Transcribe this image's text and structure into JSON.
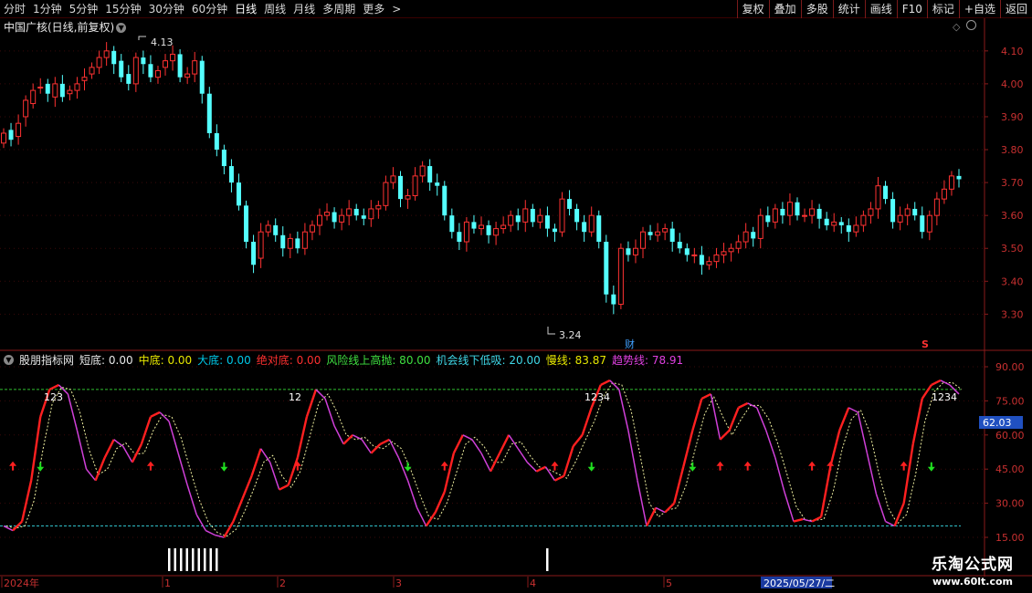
{
  "toolbar": {
    "periods": [
      {
        "label": "分时",
        "active": false
      },
      {
        "label": "1分钟",
        "active": false
      },
      {
        "label": "5分钟",
        "active": false
      },
      {
        "label": "15分钟",
        "active": false
      },
      {
        "label": "30分钟",
        "active": false
      },
      {
        "label": "60分钟",
        "active": false
      },
      {
        "label": "日线",
        "active": true
      },
      {
        "label": "周线",
        "active": false
      },
      {
        "label": "月线",
        "active": false
      },
      {
        "label": "多周期",
        "active": false
      },
      {
        "label": "更多",
        "active": false
      }
    ],
    "more_arrow": ">",
    "right_buttons": [
      "复权",
      "叠加",
      "多股",
      "统计",
      "画线",
      "F10",
      "标记",
      "+自选",
      "返回"
    ]
  },
  "stock": {
    "title": "中国广核(日线,前复权)",
    "high_label": "4.13",
    "low_label": "3.24",
    "event_marker_cai": "财",
    "event_marker_s": "S"
  },
  "price_axis": {
    "ticks": [
      "4.10",
      "4.00",
      "3.90",
      "3.80",
      "3.70",
      "3.60",
      "3.50",
      "3.40",
      "3.30"
    ]
  },
  "indicator": {
    "name": "股朋指标网",
    "values": [
      {
        "label": "短底:",
        "value": "0.00",
        "color": "#e8e8e8"
      },
      {
        "label": "中底:",
        "value": "0.00",
        "color": "#e8e800"
      },
      {
        "label": "大底:",
        "value": "0.00",
        "color": "#00c8e8"
      },
      {
        "label": "绝对底:",
        "value": "0.00",
        "color": "#ff3030"
      },
      {
        "label": "风险线上高抛:",
        "value": "80.00",
        "color": "#40e040"
      },
      {
        "label": "机会线下低吸:",
        "value": "20.00",
        "color": "#40d8e8"
      },
      {
        "label": "慢线:",
        "value": "83.87",
        "color": "#e8e800"
      },
      {
        "label": "趋势线:",
        "value": "78.91",
        "color": "#e040e0"
      }
    ],
    "axis_ticks": [
      "90.00",
      "75.00",
      "60.00",
      "45.00",
      "30.00",
      "15.00"
    ],
    "current_value_badge": "62.03",
    "peak_labels": [
      "123",
      "12",
      "1234",
      "1234"
    ]
  },
  "time_axis": {
    "labels": [
      "2024年",
      "1",
      "2",
      "3",
      "4",
      "5"
    ],
    "cursor_date": "2025/05/27/二"
  },
  "watermark": {
    "line1": "乐淘公式网",
    "line2": "www.60lt.com"
  },
  "chart_data": {
    "type": "candlestick",
    "price_ylim": [
      3.24,
      4.13
    ],
    "indicator_ylim": [
      15,
      90
    ],
    "risk_line": 80,
    "chance_line": 20,
    "closes": [
      3.85,
      3.83,
      3.88,
      3.95,
      3.98,
      3.99,
      3.97,
      4.0,
      3.96,
      3.98,
      4.0,
      4.02,
      4.05,
      4.08,
      4.1,
      4.06,
      4.02,
      4.0,
      4.08,
      4.06,
      4.02,
      4.04,
      4.07,
      4.09,
      4.02,
      4.03,
      4.07,
      3.97,
      3.85,
      3.8,
      3.75,
      3.7,
      3.63,
      3.52,
      3.45,
      3.55,
      3.57,
      3.54,
      3.5,
      3.53,
      3.5,
      3.55,
      3.57,
      3.6,
      3.61,
      3.58,
      3.6,
      3.62,
      3.6,
      3.59,
      3.62,
      3.63,
      3.7,
      3.72,
      3.65,
      3.66,
      3.72,
      3.75,
      3.7,
      3.69,
      3.6,
      3.55,
      3.52,
      3.58,
      3.56,
      3.57,
      3.54,
      3.56,
      3.57,
      3.6,
      3.58,
      3.62,
      3.58,
      3.6,
      3.56,
      3.55,
      3.65,
      3.62,
      3.58,
      3.55,
      3.6,
      3.52,
      3.36,
      3.33,
      3.5,
      3.48,
      3.5,
      3.55,
      3.54,
      3.55,
      3.56,
      3.52,
      3.5,
      3.48,
      3.48,
      3.45,
      3.46,
      3.48,
      3.49,
      3.5,
      3.52,
      3.55,
      3.53,
      3.6,
      3.58,
      3.62,
      3.6,
      3.64,
      3.6,
      3.6,
      3.62,
      3.59,
      3.57,
      3.58,
      3.57,
      3.55,
      3.57,
      3.6,
      3.62,
      3.69,
      3.65,
      3.58,
      3.6,
      3.62,
      3.6,
      3.55,
      3.6,
      3.65,
      3.68,
      3.72,
      3.71
    ],
    "opens": [
      3.82,
      3.86,
      3.84,
      3.9,
      3.94,
      3.99,
      4.0,
      3.96,
      4.0,
      3.97,
      3.98,
      4.01,
      4.03,
      4.05,
      4.08,
      4.1,
      4.07,
      4.03,
      4.0,
      4.08,
      4.06,
      4.02,
      4.05,
      4.07,
      4.09,
      4.02,
      4.03,
      4.07,
      3.97,
      3.85,
      3.8,
      3.75,
      3.7,
      3.63,
      3.52,
      3.47,
      3.55,
      3.57,
      3.54,
      3.5,
      3.53,
      3.5,
      3.55,
      3.57,
      3.6,
      3.61,
      3.58,
      3.6,
      3.62,
      3.6,
      3.59,
      3.62,
      3.63,
      3.7,
      3.72,
      3.65,
      3.66,
      3.72,
      3.75,
      3.7,
      3.69,
      3.6,
      3.55,
      3.52,
      3.58,
      3.56,
      3.57,
      3.54,
      3.56,
      3.57,
      3.6,
      3.58,
      3.62,
      3.58,
      3.6,
      3.56,
      3.55,
      3.65,
      3.62,
      3.58,
      3.55,
      3.6,
      3.52,
      3.36,
      3.33,
      3.5,
      3.48,
      3.5,
      3.55,
      3.54,
      3.55,
      3.56,
      3.52,
      3.5,
      3.48,
      3.48,
      3.45,
      3.46,
      3.48,
      3.49,
      3.5,
      3.52,
      3.55,
      3.53,
      3.6,
      3.58,
      3.62,
      3.6,
      3.64,
      3.6,
      3.6,
      3.62,
      3.59,
      3.57,
      3.58,
      3.57,
      3.55,
      3.57,
      3.6,
      3.62,
      3.69,
      3.65,
      3.58,
      3.6,
      3.62,
      3.6,
      3.55,
      3.6,
      3.65,
      3.68,
      3.72
    ],
    "trend_line": [
      20,
      18,
      22,
      40,
      68,
      80,
      82,
      78,
      62,
      45,
      40,
      50,
      58,
      55,
      48,
      56,
      68,
      70,
      66,
      52,
      38,
      25,
      18,
      16,
      15,
      22,
      32,
      42,
      54,
      48,
      36,
      38,
      50,
      68,
      80,
      76,
      64,
      56,
      60,
      58,
      52,
      56,
      58,
      50,
      40,
      28,
      20,
      26,
      35,
      52,
      60,
      58,
      52,
      44,
      52,
      60,
      54,
      48,
      44,
      46,
      40,
      42,
      55,
      60,
      72,
      82,
      84,
      80,
      62,
      40,
      20,
      28,
      26,
      30,
      46,
      62,
      76,
      78,
      58,
      62,
      72,
      74,
      72,
      62,
      50,
      35,
      22,
      23,
      22,
      24,
      46,
      62,
      72,
      70,
      52,
      34,
      22,
      20,
      30,
      56,
      76,
      82,
      84,
      82,
      78
    ],
    "markers_up": [
      1,
      16,
      32,
      48,
      60,
      78,
      81,
      88,
      90,
      98
    ],
    "markers_down": [
      4,
      24,
      44,
      64,
      75,
      101
    ]
  }
}
